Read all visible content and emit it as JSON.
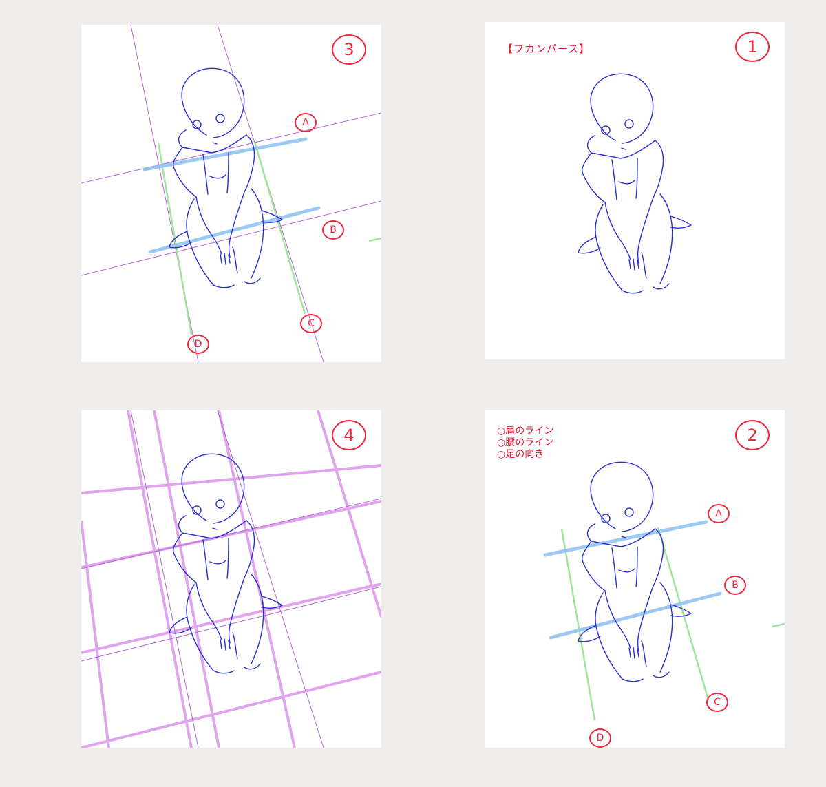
{
  "panels": {
    "p3": {
      "number": "3",
      "markers": {
        "a": "A",
        "b": "B",
        "c": "C",
        "d": "D"
      }
    },
    "p1": {
      "number": "1",
      "title": "【フカンパース】"
    },
    "p4": {
      "number": "4"
    },
    "p2": {
      "number": "2",
      "notes": [
        "○肩のライン",
        "○腰のライン",
        "○足の向き"
      ],
      "markers": {
        "a": "A",
        "b": "B",
        "c": "C",
        "d": "D"
      }
    }
  },
  "colors": {
    "background": "#eeedeb",
    "panel": "#ffffff",
    "sketch": "#2a2fd0",
    "annotation": "#f0263a",
    "guide_blue": "#8bc0ef",
    "guide_green": "#9ee59a",
    "guide_purple": "#b06ad8",
    "grid_magenta": "#d98ee8"
  }
}
